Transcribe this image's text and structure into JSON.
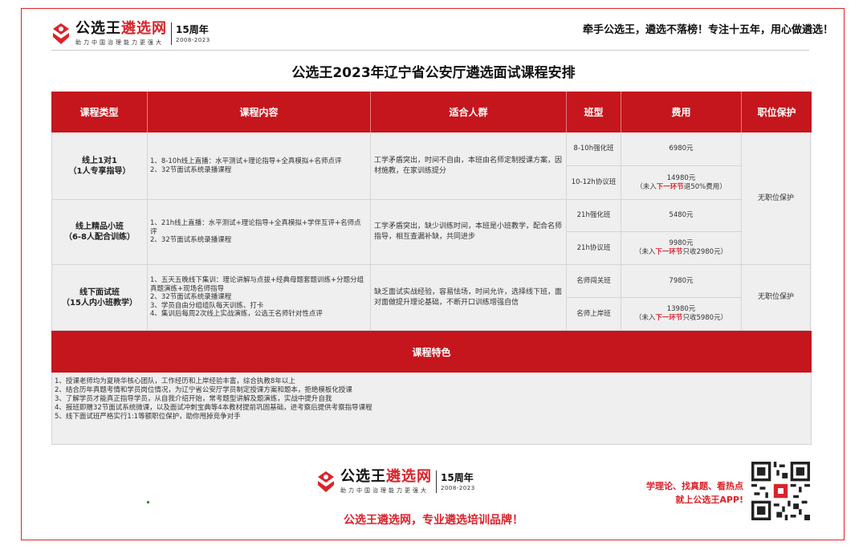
{
  "brand": {
    "name_black": "公选王",
    "name_red": "遴选网",
    "slogan": "助力中国治理能力更强大",
    "anniversary": "15周年",
    "years": "2008-2023",
    "icon": "brand-logo-icon",
    "color": "#d9232a"
  },
  "header": {
    "tagline": "牵手公选王，遴选不落榜！专注十五年，用心做遴选！"
  },
  "title": "公选王2023年辽宁省公安厅遴选面试课程安排",
  "table": {
    "headers": [
      "课程类型",
      "课程内容",
      "适合人群",
      "班型",
      "费用",
      "职位保护"
    ],
    "header_color": "#c4161c",
    "groups": [
      {
        "type_line1": "线上1对1",
        "type_line2": "（1人专享指导）",
        "content": [
          "1、8-10h线上直播：水平测试+理论指导+全真模拟+名师点评",
          "2、32节面试系统录播课程"
        ],
        "audience": "工学矛盾突出，时间不自由，本班由名师定制授课方案，因材施教，在家训练提分",
        "rows": [
          {
            "class": "8-10h强化班",
            "fee": "6980元"
          },
          {
            "class": "10-12h协议班",
            "fee": "14980元",
            "note_pre": "（未入",
            "note_hl": "下一环节",
            "note_post": "退50%费用）"
          }
        ]
      },
      {
        "type_line1": "线上精品小班",
        "type_line2": "（6-8人配合训练）",
        "content": [
          "1、21h线上直播：水平测试+理论指导+全真模拟+学伴互评+名师点评",
          "2、32节面试系统录播课程"
        ],
        "audience": "工学矛盾突出，缺少训练时间，本班是小班教学，配合名师指导，相互查漏补缺，共同进步",
        "rows": [
          {
            "class": "21h强化班",
            "fee": "5480元"
          },
          {
            "class": "21h协议班",
            "fee": "9980元",
            "note_pre": "（未入",
            "note_hl": "下一环节",
            "note_post": "只收2980元）"
          }
        ]
      },
      {
        "type_line1": "线下面试班",
        "type_line2": "（15人内小班教学）",
        "content": [
          "1、五天五晚线下集训：理论讲解与点拔+经典母题套题训练+分题分组真题演练+现场名师指导",
          "2、32节面试系统录播课程",
          "3、学员自由分组组队每天训练、打卡",
          "4、集训后每周2次线上实战演练，公选王名师针对性点评"
        ],
        "audience": "缺乏面试实战经验，容易怯场，时间允许，选择线下班，面对面做提升理论基础，不断开口训练增强自信",
        "rows": [
          {
            "class": "名师闯关班",
            "fee": "7980元"
          },
          {
            "class": "名师上岸班",
            "fee": "13980元",
            "note_pre": "（未入",
            "note_hl": "下一环节",
            "note_post": "只收5980元）"
          }
        ]
      }
    ],
    "protection_top": "无职位保护",
    "protection_bottom": "无职位保护"
  },
  "features": {
    "title": "课程特色",
    "items": [
      "1、授课老师均为夏晓华核心团队，工作经历和上岸经验丰富，综合执教8年以上",
      "2、结合历年真题考情和学员岗位情况，为辽宁省公安厅学员制定授课方案和题本，拒绝模板化授课",
      "3、了解学员才能真正指导学员，从自我介绍开始，常考题型讲解及题演练，实战中提升自我",
      "4、报班即赠32节面试系统微课，以及面试冲刺宝典等4本教材提前巩固基础，进考察后提供考察指导课程",
      "5、线下面试班严格实行1:1等额职位保护，助你甩掉竞争对手"
    ]
  },
  "footer": {
    "promo_line1": "学理论、找真题、看热点",
    "promo_line2": "就上公选王APP!",
    "slogan": "公选王遴选网，专业遴选培训品牌！",
    "qr_icon": "qr-code-icon"
  }
}
